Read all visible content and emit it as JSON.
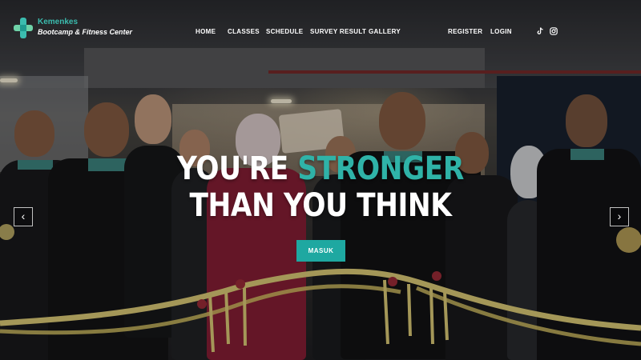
{
  "brand": {
    "name": "Kemenkes",
    "tagline": "Bootcamp & Fitness Center"
  },
  "nav": {
    "items": [
      {
        "label": "HOME"
      },
      {
        "label": "CLASSES"
      },
      {
        "label": "SCHEDULE"
      },
      {
        "label": "SURVEY RESULT"
      },
      {
        "label": "GALLERY"
      }
    ],
    "register_label": "REGISTER",
    "login_label": "LOGIN",
    "social": [
      {
        "icon": "tiktok-icon"
      },
      {
        "icon": "instagram-icon"
      }
    ]
  },
  "hero": {
    "line1_prefix": "YOU'RE ",
    "line1_accent": "STRONGER",
    "line2": "THAN YOU THINK",
    "cta_label": "MASUK",
    "prev_icon": "chevron-left-icon",
    "next_icon": "chevron-right-icon"
  },
  "colors": {
    "accent": "#2fb3a8",
    "button": "#1ea8a1",
    "brand_text": "#3bbcae"
  }
}
